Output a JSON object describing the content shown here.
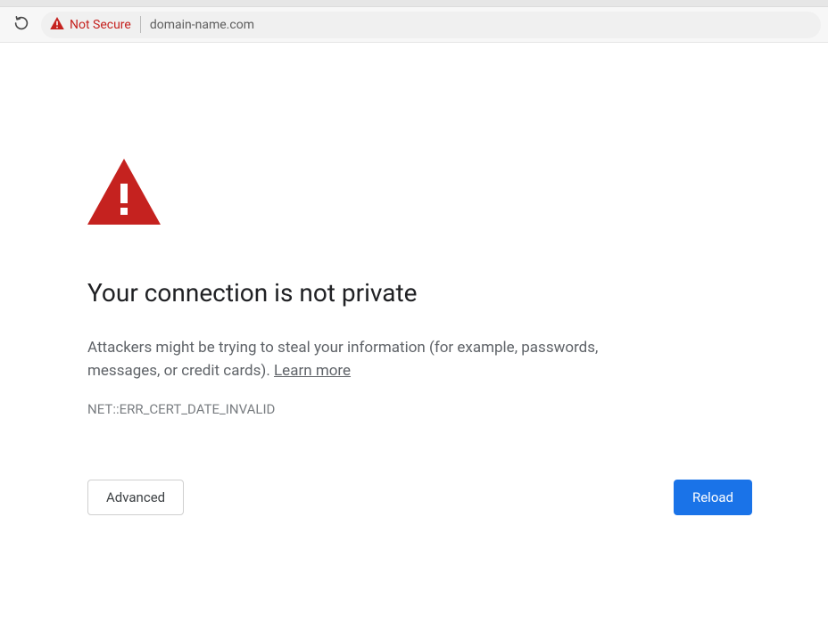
{
  "toolbar": {
    "security_label": "Not Secure",
    "url": "domain-name.com"
  },
  "page": {
    "heading": "Your connection is not private",
    "description_part1": "Attackers might be trying to steal your information (for example, passwords, messages, or credit cards). ",
    "learn_more_label": "Learn more",
    "error_code": "NET::ERR_CERT_DATE_INVALID",
    "advanced_label": "Advanced",
    "reload_label": "Reload"
  },
  "colors": {
    "warning_red": "#c5221f",
    "primary_blue": "#1a73e8"
  }
}
